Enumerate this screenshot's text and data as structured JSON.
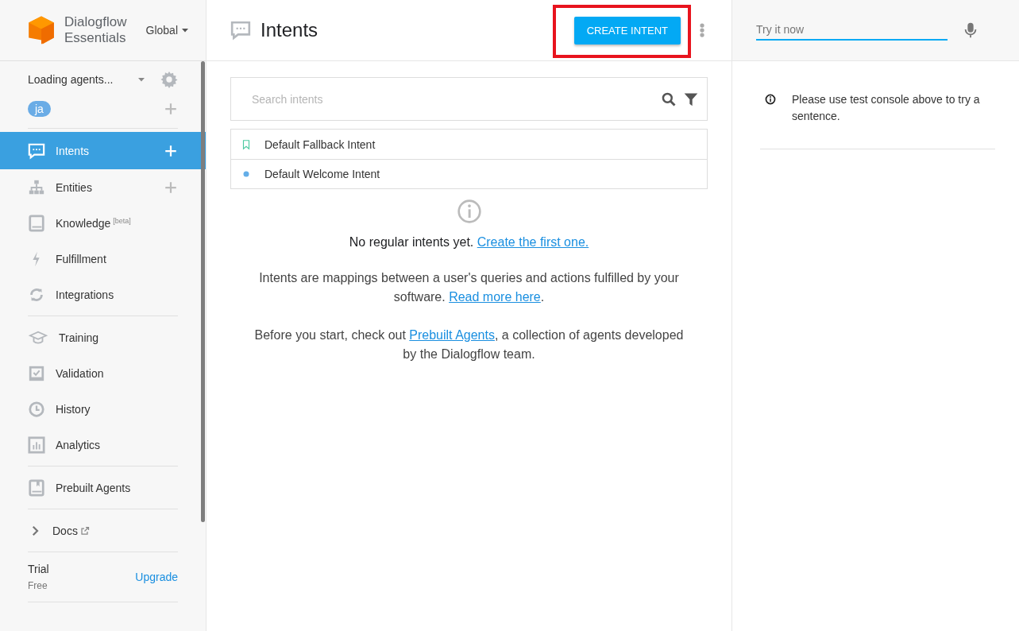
{
  "brand": {
    "line1": "Dialogflow",
    "line2": "Essentials",
    "region": "Global"
  },
  "agent": {
    "label": "Loading agents...",
    "language": "ja"
  },
  "nav": [
    [
      {
        "kind": "intents",
        "label": "Intents",
        "selected": true,
        "add": true
      },
      {
        "kind": "entities",
        "label": "Entities",
        "selected": false,
        "add": true
      },
      {
        "kind": "knowledge",
        "label": "Knowledge",
        "sup": "[beta]",
        "selected": false,
        "add": false
      },
      {
        "kind": "fulfillment",
        "label": "Fulfillment",
        "selected": false,
        "add": false
      },
      {
        "kind": "integrations",
        "label": "Integrations",
        "selected": false,
        "add": false
      }
    ],
    [
      {
        "kind": "training",
        "label": "Training",
        "selected": false,
        "add": false
      },
      {
        "kind": "validation",
        "label": "Validation",
        "selected": false,
        "add": false
      },
      {
        "kind": "history",
        "label": "History",
        "selected": false,
        "add": false
      },
      {
        "kind": "analytics",
        "label": "Analytics",
        "selected": false,
        "add": false
      }
    ],
    [
      {
        "kind": "prebuilt",
        "label": "Prebuilt Agents",
        "selected": false,
        "add": false
      }
    ],
    [
      {
        "kind": "docs",
        "label": "Docs",
        "selected": false,
        "add": false
      }
    ]
  ],
  "plan": {
    "name": "Trial",
    "tier": "Free",
    "action": "Upgrade"
  },
  "header": {
    "title": "Intents",
    "button": "CREATE INTENT",
    "highlighted": true
  },
  "search": {
    "placeholder": "Search intents"
  },
  "intents": [
    {
      "kind": "fallback",
      "name": "Default Fallback Intent"
    },
    {
      "kind": "welcome",
      "name": "Default Welcome Intent"
    }
  ],
  "empty": {
    "title": [
      {
        "text": "No regular intents yet. "
      },
      {
        "link": "Create the first one."
      }
    ],
    "paragraphs": [
      [
        {
          "text": "Intents are mappings between a user's queries and actions fulfilled by your software. "
        },
        {
          "link": "Read more here"
        },
        {
          "text": "."
        }
      ],
      [
        {
          "text": "Before you start, check out "
        },
        {
          "link": "Prebuilt Agents"
        },
        {
          "text": ", a collection of agents developed by the Dialogflow team."
        }
      ]
    ]
  },
  "console": {
    "placeholder": "Try it now",
    "message": "Please use test console above to try a sentence."
  }
}
